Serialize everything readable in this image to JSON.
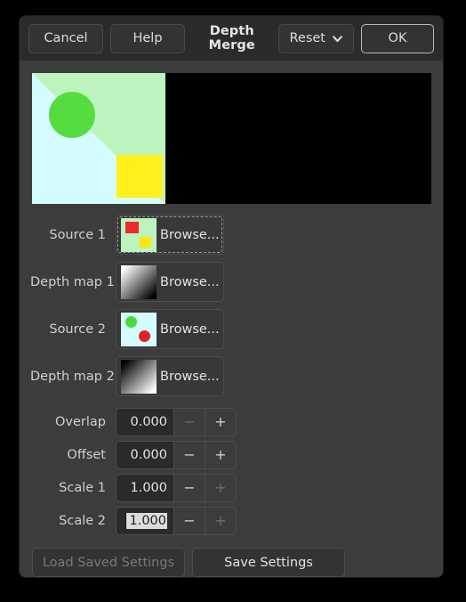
{
  "titlebar": {
    "cancel_label": "Cancel",
    "help_label": "Help",
    "title": "Depth Merge",
    "reset_label": "Reset",
    "reset_icon": "chevron-down-icon",
    "ok_label": "OK"
  },
  "preview": {
    "background_color": "#000000",
    "image": {
      "background_color": "#d4fcff",
      "triangle_color": "#bdf3bd",
      "circle_color": "#55dd3f",
      "square_color": "#ffef1b"
    }
  },
  "sources": [
    {
      "label": "Source 1",
      "button_label": "Browse...",
      "thumbnail": "source1-thumbnail",
      "focused": true
    },
    {
      "label": "Depth map 1",
      "button_label": "Browse...",
      "thumbnail": "depth-map-1-thumbnail",
      "focused": false
    },
    {
      "label": "Source 2",
      "button_label": "Browse...",
      "thumbnail": "source2-thumbnail",
      "focused": false
    },
    {
      "label": "Depth map 2",
      "button_label": "Browse...",
      "thumbnail": "depth-map-2-thumbnail",
      "focused": false
    }
  ],
  "spinners": [
    {
      "label": "Overlap",
      "value": "0.000",
      "minus_label": "−",
      "plus_label": "+",
      "minus_enabled": false,
      "plus_enabled": true,
      "selected": false
    },
    {
      "label": "Offset",
      "value": "0.000",
      "minus_label": "−",
      "plus_label": "+",
      "minus_enabled": true,
      "plus_enabled": true,
      "selected": false
    },
    {
      "label": "Scale 1",
      "value": "1.000",
      "minus_label": "−",
      "plus_label": "+",
      "minus_enabled": true,
      "plus_enabled": false,
      "selected": false
    },
    {
      "label": "Scale 2",
      "value": "1.000",
      "minus_label": "−",
      "plus_label": "+",
      "minus_enabled": true,
      "plus_enabled": false,
      "selected": true
    }
  ],
  "bottom": {
    "load_label": "Load Saved Settings",
    "load_enabled": false,
    "save_label": "Save Settings",
    "save_enabled": true
  }
}
